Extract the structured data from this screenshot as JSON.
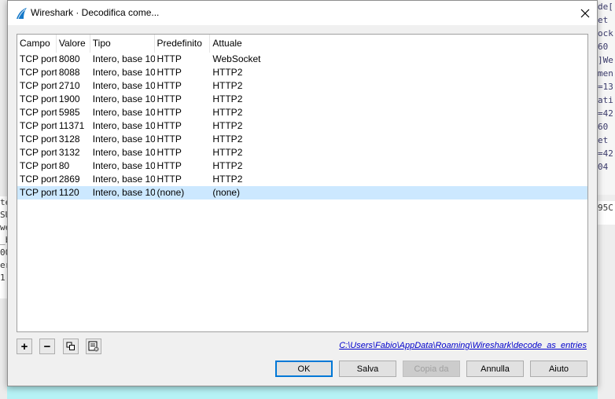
{
  "background": {
    "right_lines": [
      "de[",
      "et ",
      "ock",
      "60 ",
      "]We",
      "",
      "men",
      "=13",
      "ati",
      "=42",
      "60 ",
      "et ",
      "=42",
      "04 "
    ],
    "right_lines2": [
      "95C"
    ],
    "left_lines": [
      "te",
      "SU",
      "we",
      "_b",
      "00",
      "er",
      "1"
    ]
  },
  "window": {
    "title": "Wireshark · Decodifica come...",
    "close_glyph": "✕"
  },
  "table": {
    "columns": [
      "Campo",
      "Valore",
      "Tipo",
      "Predefinito",
      "Attuale"
    ],
    "rows": [
      {
        "campo": "TCP port",
        "valore": "8080",
        "tipo": "Intero, base 10",
        "predefinito": "HTTP",
        "attuale": "WebSocket"
      },
      {
        "campo": "TCP port",
        "valore": "8088",
        "tipo": "Intero, base 10",
        "predefinito": "HTTP",
        "attuale": "HTTP2"
      },
      {
        "campo": "TCP port",
        "valore": "2710",
        "tipo": "Intero, base 10",
        "predefinito": "HTTP",
        "attuale": "HTTP2"
      },
      {
        "campo": "TCP port",
        "valore": "1900",
        "tipo": "Intero, base 10",
        "predefinito": "HTTP",
        "attuale": "HTTP2"
      },
      {
        "campo": "TCP port",
        "valore": "5985",
        "tipo": "Intero, base 10",
        "predefinito": "HTTP",
        "attuale": "HTTP2"
      },
      {
        "campo": "TCP port",
        "valore": "11371",
        "tipo": "Intero, base 10",
        "predefinito": "HTTP",
        "attuale": "HTTP2"
      },
      {
        "campo": "TCP port",
        "valore": "3128",
        "tipo": "Intero, base 10",
        "predefinito": "HTTP",
        "attuale": "HTTP2"
      },
      {
        "campo": "TCP port",
        "valore": "3132",
        "tipo": "Intero, base 10",
        "predefinito": "HTTP",
        "attuale": "HTTP2"
      },
      {
        "campo": "TCP port",
        "valore": "80",
        "tipo": "Intero, base 10",
        "predefinito": "HTTP",
        "attuale": "HTTP2"
      },
      {
        "campo": "TCP port",
        "valore": "2869",
        "tipo": "Intero, base 10",
        "predefinito": "HTTP",
        "attuale": "HTTP2"
      },
      {
        "campo": "TCP port",
        "valore": "1120",
        "tipo": "Intero, base 10",
        "predefinito": "(none)",
        "attuale": "(none)",
        "selected": true
      }
    ]
  },
  "toolbar": {
    "add_glyph": "+",
    "remove_glyph": "−",
    "icons": [
      "add-icon",
      "remove-icon",
      "copy-icon",
      "clear-icon"
    ]
  },
  "path": "C:\\Users\\Fabio\\AppData\\Roaming\\Wireshark\\decode_as_entries",
  "buttons": {
    "ok": "OK",
    "save": "Salva",
    "copy_from": "Copia da",
    "cancel": "Annulla",
    "help": "Aiuto"
  },
  "colors": {
    "selection": "#cce8ff",
    "link": "#0000cc",
    "accent": "#0078d7"
  }
}
